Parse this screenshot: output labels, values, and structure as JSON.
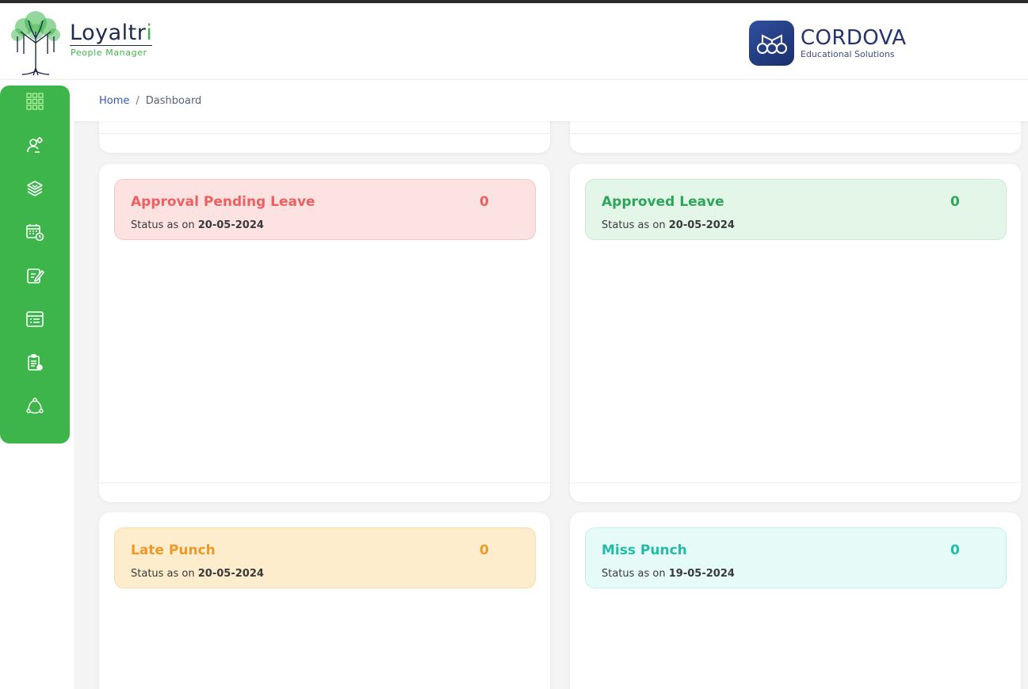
{
  "brand": {
    "name_main": "Loyaltr",
    "name_accent": "i",
    "subtitle": "People Manager"
  },
  "partner": {
    "name": "CORDOVA",
    "subtitle": "Educational Solutions"
  },
  "sidebar": {
    "items": [
      {
        "icon": "dashboard-grid-icon"
      },
      {
        "icon": "user-settings-icon"
      },
      {
        "icon": "layers-icon"
      },
      {
        "icon": "calendar-clock-icon"
      },
      {
        "icon": "edit-note-icon"
      },
      {
        "icon": "list-window-icon"
      },
      {
        "icon": "clipboard-icon"
      },
      {
        "icon": "network-cycle-icon"
      }
    ]
  },
  "breadcrumb": {
    "home": "Home",
    "separator": "/",
    "current": "Dashboard"
  },
  "cards": [
    {
      "title": "Approval Pending Leave",
      "count": "0",
      "status_prefix": "Status as on",
      "date": "20-05-2024",
      "color": "#ef5f5f"
    },
    {
      "title": "Approved Leave",
      "count": "0",
      "status_prefix": "Status as on",
      "date": "20-05-2024",
      "color": "#2ea55a"
    },
    {
      "title": "Late Punch",
      "count": "0",
      "status_prefix": "Status as on",
      "date": "20-05-2024",
      "color": "#ee9a2a"
    },
    {
      "title": "Miss Punch",
      "count": "0",
      "status_prefix": "Status as on",
      "date": "19-05-2024",
      "color": "#22bca6"
    }
  ],
  "colors": {
    "sidebar": "#3db54a",
    "brand_dark": "#1c2b4a",
    "partner_blue": "#23346e"
  }
}
